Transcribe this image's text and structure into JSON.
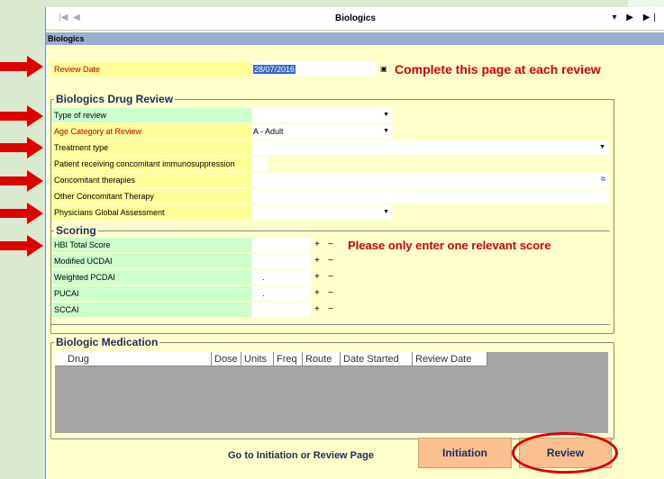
{
  "window": {
    "title": "Biologics",
    "header": "Biologics"
  },
  "nav": {
    "first": "|◀",
    "prev": "◀",
    "right": "▾ ▶ ▶|"
  },
  "review_date": {
    "label": "Review Date",
    "value": "28/07/2016",
    "calendar_icon": "calendar-icon"
  },
  "info": {
    "complete_msg": "Complete this page at each review",
    "score_msg": "Please only enter one relevant score"
  },
  "drug_review": {
    "legend": "Biologics Drug Review",
    "type_of_review": {
      "label": "Type of review",
      "value": ""
    },
    "age_category": {
      "label": "Age Category at Review",
      "value": "A - Adult"
    },
    "treatment_type": {
      "label": "Treatment type",
      "value": ""
    },
    "concomitant_immuno": {
      "label": "Patient receiving concomitant immunosuppression",
      "value": ""
    },
    "concomitant_therapies": {
      "label": "Concomitant therapies",
      "value": ""
    },
    "other_concomitant": {
      "label": "Other Concomitant Therapy",
      "value": ""
    },
    "physicians_assessment": {
      "label": "Physicians Global Assessment",
      "value": ""
    }
  },
  "scoring": {
    "legend": "Scoring",
    "items": [
      {
        "label": "HBI Total Score",
        "value": ""
      },
      {
        "label": "Modified UCDAI",
        "value": ""
      },
      {
        "label": "Weighted PCDAI",
        "value": "."
      },
      {
        "label": "PUCAI",
        "value": "."
      },
      {
        "label": "SCCAI",
        "value": ""
      }
    ],
    "plus": "+",
    "minus": "−"
  },
  "medication": {
    "legend": "Biologic Medication",
    "columns": [
      "Drug",
      "Dose",
      "Units",
      "Freq",
      "Route",
      "Date Started",
      "Review Date"
    ]
  },
  "footer": {
    "goto_label": "Go to Initiation or Review Page",
    "initiation": "Initiation",
    "review": "Review"
  },
  "colors": {
    "accent_red": "#dd0000",
    "label_yellow": "#ffff99",
    "label_green": "#ccffcc",
    "button": "#fac090"
  }
}
